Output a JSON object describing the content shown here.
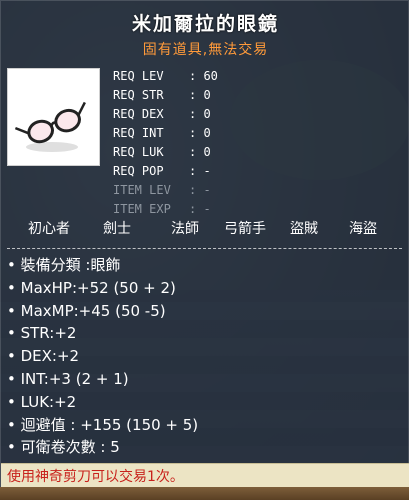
{
  "item": {
    "name": "米加爾拉的眼鏡",
    "subtitle": "固有道具,無法交易",
    "icon": "glasses-icon"
  },
  "requirements": [
    {
      "label": "REQ LEV",
      "value": ": 60",
      "met": true
    },
    {
      "label": "REQ STR",
      "value": ": 0",
      "met": true
    },
    {
      "label": "REQ DEX",
      "value": ": 0",
      "met": true
    },
    {
      "label": "REQ INT",
      "value": ": 0",
      "met": true
    },
    {
      "label": "REQ LUK",
      "value": ": 0",
      "met": true
    },
    {
      "label": "REQ POP",
      "value": ": -",
      "met": true
    },
    {
      "label": "ITEM LEV",
      "value": ": -",
      "met": false
    },
    {
      "label": "ITEM EXP",
      "value": ": -",
      "met": false
    }
  ],
  "jobs": [
    "初心者",
    "劍士",
    "法師",
    "弓箭手",
    "盜賊",
    "海盜"
  ],
  "stats": [
    "裝備分類 :眼飾",
    "MaxHP:+52 (50 + 2)",
    "MaxMP:+45 (50 -5)",
    "STR:+2",
    "DEX:+2",
    "INT:+3 (2 + 1)",
    "LUK:+2",
    "迴避值 : +155 (150 + 5)",
    "可衛卷次數 : 5"
  ],
  "footer_note": "使用神奇剪刀可以交易1次。",
  "colors": {
    "title": "#ffffff",
    "subtitle": "#ff9a3a",
    "req_met": "#ffffff",
    "req_unmet": "#8e96a0",
    "footer_text": "#c8221c",
    "footer_bg": "#ece4c4"
  }
}
